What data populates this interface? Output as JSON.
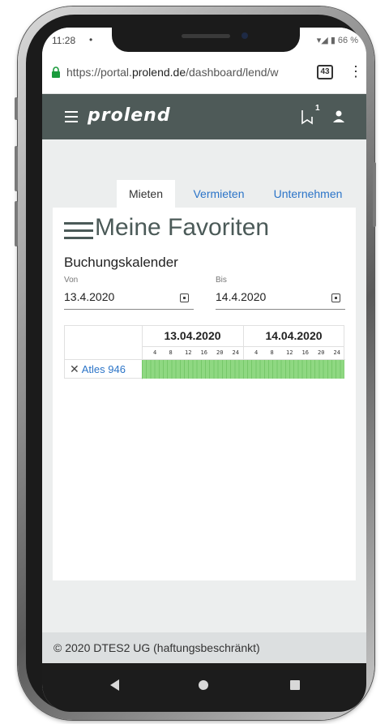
{
  "status_bar": {
    "time": "11:28",
    "dot": "•",
    "icons_text": "▾◢ ▮ 66 %"
  },
  "browser": {
    "url_prefix": "https://portal.",
    "url_host": "prolend.de",
    "url_path": "/dashboard/lend/w",
    "tab_count": "43",
    "menu_glyph": "⋮"
  },
  "app_header": {
    "logo": "prolend",
    "notification_badge": "1"
  },
  "tabs": [
    {
      "label": "Mieten",
      "active": true
    },
    {
      "label": "Vermieten",
      "active": false
    },
    {
      "label": "Unternehmen",
      "active": false
    }
  ],
  "page": {
    "title": "Meine Favoriten",
    "section_title": "Buchungskalender"
  },
  "date_range": {
    "from_label": "Von",
    "from_value": "13.4.2020",
    "to_label": "Bis",
    "to_value": "14.4.2020"
  },
  "calendar": {
    "dates": [
      "13.04.2020",
      "14.04.2020"
    ],
    "hours": [
      "4",
      "8",
      "12",
      "16",
      "20",
      "24"
    ],
    "resources": [
      {
        "name": "Atles 946",
        "remove_glyph": "✕",
        "booked_fraction": 1.0
      }
    ],
    "bar_color": "#8fd882"
  },
  "footer": {
    "text": "© 2020 DTES2 UG (haftungsbeschränkt)"
  },
  "colors": {
    "appbar": "#4e5a58",
    "link": "#2b74c8",
    "title": "#4b5a58"
  }
}
